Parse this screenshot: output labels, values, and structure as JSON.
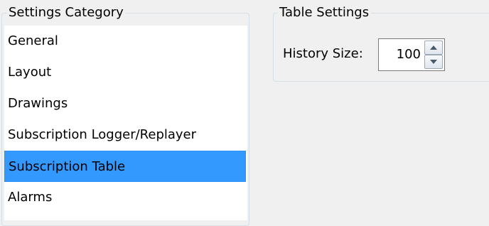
{
  "settings_category": {
    "title": "Settings Category",
    "items": [
      {
        "label": "General",
        "selected": false
      },
      {
        "label": "Layout",
        "selected": false
      },
      {
        "label": "Drawings",
        "selected": false
      },
      {
        "label": "Subscription Logger/Replayer",
        "selected": false
      },
      {
        "label": "Subscription Table",
        "selected": true
      },
      {
        "label": "Alarms",
        "selected": false
      }
    ]
  },
  "table_settings": {
    "title": "Table Settings",
    "history_size_label": "History Size:",
    "history_size_value": "100"
  },
  "colors": {
    "selection": "#3399ff",
    "background": "#f0f0f0"
  },
  "icons": {
    "spin_up": "arrow-up-icon",
    "spin_down": "arrow-down-icon"
  }
}
